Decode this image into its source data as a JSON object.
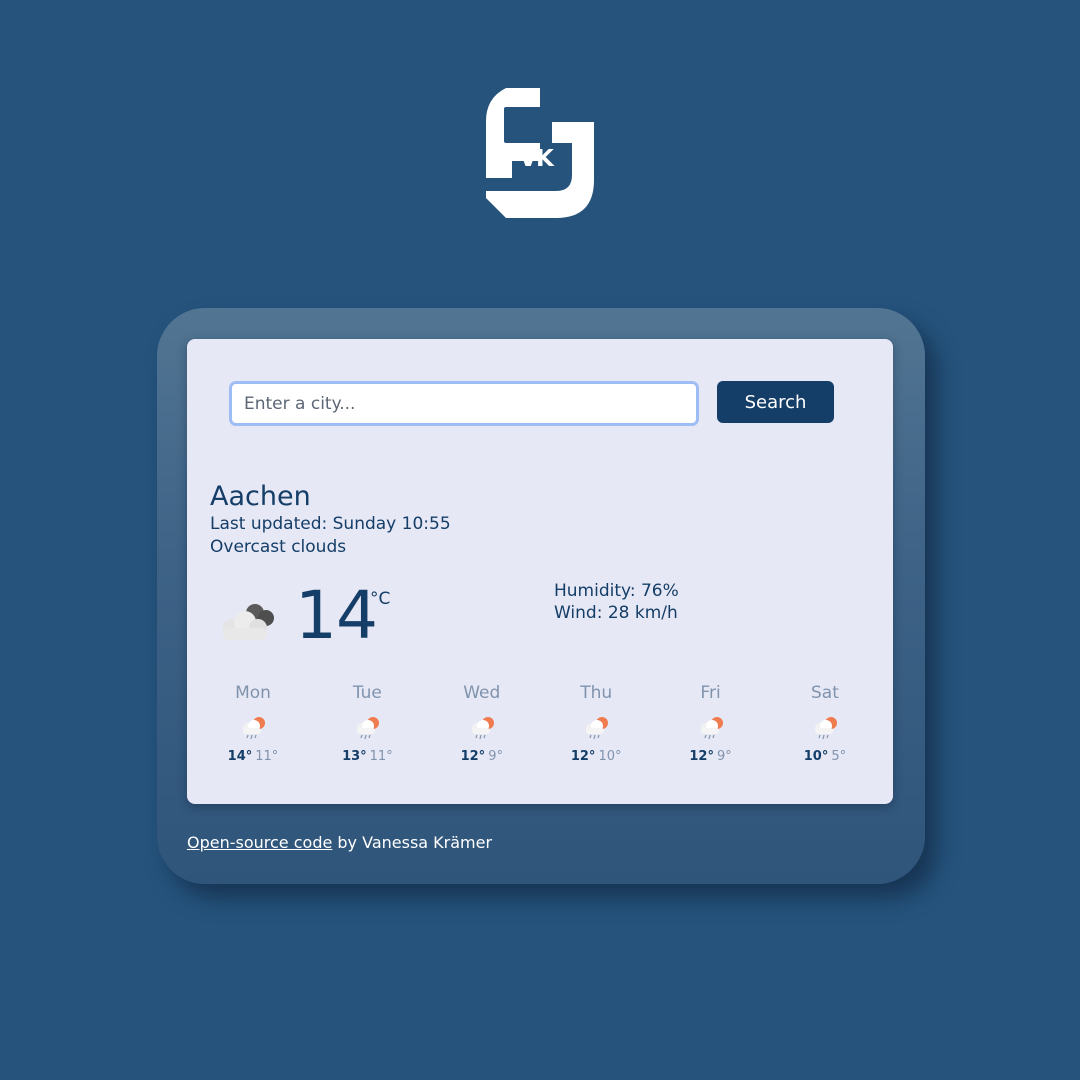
{
  "logo": {
    "text": "VK"
  },
  "search": {
    "placeholder": "Enter a city...",
    "value": "",
    "button_label": "Search"
  },
  "current": {
    "city": "Aachen",
    "last_updated": "Last updated: Sunday 10:55",
    "description": "Overcast clouds",
    "icon": "overcast-clouds-icon",
    "temperature": "14",
    "unit": "°C",
    "humidity": "Humidity: 76%",
    "wind": "Wind: 28 km/h"
  },
  "forecast": [
    {
      "day": "Mon",
      "max": "14°",
      "min": "11°",
      "icon": "rain-sun-icon"
    },
    {
      "day": "Tue",
      "max": "13°",
      "min": "11°",
      "icon": "rain-sun-icon"
    },
    {
      "day": "Wed",
      "max": "12°",
      "min": "9°",
      "icon": "rain-sun-icon"
    },
    {
      "day": "Thu",
      "max": "12°",
      "min": "10°",
      "icon": "rain-sun-icon"
    },
    {
      "day": "Fri",
      "max": "12°",
      "min": "9°",
      "icon": "rain-sun-icon"
    },
    {
      "day": "Sat",
      "max": "10°",
      "min": "5°",
      "icon": "rain-sun-icon"
    }
  ],
  "footer": {
    "link_text": "Open-source code",
    "suffix": " by Vanessa Krämer"
  },
  "colors": {
    "background": "#25537c",
    "card": "#e7e8f6",
    "primary": "#143e67",
    "muted": "#8093ac",
    "input_focus": "#9fbdf5"
  }
}
